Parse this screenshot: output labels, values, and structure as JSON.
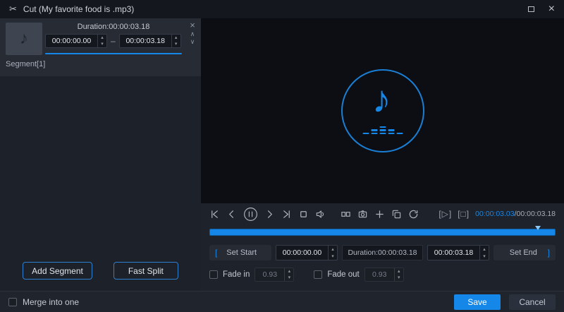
{
  "titlebar": {
    "title": "Cut (My favorite food is .mp3)"
  },
  "icons": {
    "scissors": "✂",
    "close": "×",
    "music_note": "♪",
    "dash": "–",
    "spin_up": "▴",
    "spin_down": "▾",
    "chevron_up": "∧",
    "chevron_down": "∨",
    "bracket_play": "[▷]",
    "bracket_stop": "[□]",
    "bracket_open": "[",
    "bracket_close": "]"
  },
  "segment_panel": {
    "duration_label": "Duration:00:00:03.18",
    "start_value": "00:00:00.00",
    "end_value": "00:00:03.18",
    "segment_label": "Segment[1]",
    "add_segment_button": "Add Segment",
    "fast_split_button": "Fast Split"
  },
  "player": {
    "current_time": "00:00:03.03",
    "time_separator": "/",
    "total_time": "00:00:03.18",
    "progress_percent": 95
  },
  "trim": {
    "set_start_label": "Set Start",
    "start_value": "00:00:00.00",
    "duration_label": "Duration:00:00:03.18",
    "end_value": "00:00:03.18",
    "set_end_label": "Set End",
    "fade_in_label": "Fade in",
    "fade_in_value": "0.93",
    "fade_out_label": "Fade out",
    "fade_out_value": "0.93"
  },
  "footer": {
    "merge_label": "Merge into one",
    "save_button": "Save",
    "cancel_button": "Cancel"
  },
  "colors": {
    "accent": "#1487e8"
  }
}
